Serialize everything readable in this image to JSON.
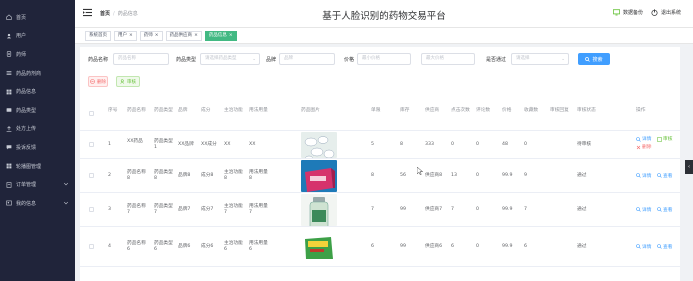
{
  "sidebar": {
    "items": [
      {
        "label": "首页",
        "icon": "home-icon",
        "caret": false
      },
      {
        "label": "用户",
        "icon": "user-icon",
        "caret": false
      },
      {
        "label": "药师",
        "icon": "pharmacist-icon",
        "caret": false
      },
      {
        "label": "药品药剂商",
        "icon": "supplier-icon",
        "caret": false
      },
      {
        "label": "药品信息",
        "icon": "drug-info-icon",
        "caret": false
      },
      {
        "label": "药品类型",
        "icon": "drug-type-icon",
        "caret": false
      },
      {
        "label": "处方上传",
        "icon": "upload-icon",
        "caret": false
      },
      {
        "label": "投诉反馈",
        "icon": "feedback-icon",
        "caret": false
      },
      {
        "label": "轮播图管理",
        "icon": "carousel-icon",
        "caret": false
      },
      {
        "label": "订单管理",
        "icon": "order-icon",
        "caret": true
      },
      {
        "label": "我的信息",
        "icon": "profile-icon",
        "caret": true
      }
    ]
  },
  "header": {
    "breadcrumb_home": "首页",
    "breadcrumb_current": "药品信息",
    "system_title": "基于人脸识别的药物交易平台",
    "backup_label": "数据备份",
    "logout_label": "退出系统"
  },
  "tabs": [
    {
      "label": "系统首页",
      "closable": false,
      "active": false
    },
    {
      "label": "用户",
      "closable": true,
      "active": false
    },
    {
      "label": "药师",
      "closable": true,
      "active": false
    },
    {
      "label": "药品供应商",
      "closable": true,
      "active": false
    },
    {
      "label": "药品信息",
      "closable": true,
      "active": true
    }
  ],
  "search": {
    "name_label": "药品名称",
    "name_placeholder": "药品名称",
    "type_label": "药品类型",
    "type_placeholder": "请选择药品类型",
    "brand_label": "品牌",
    "brand_placeholder": "品牌",
    "price_label": "价格",
    "price_min_placeholder": "最小价格",
    "price_max_placeholder": "最大价格",
    "audit_label": "是否通过",
    "audit_placeholder": "请选择",
    "search_button": "搜索"
  },
  "actions": {
    "delete_label": "删除",
    "audit_label": "审核"
  },
  "table": {
    "columns": [
      "序号",
      "药品名称",
      "药品类型",
      "品牌",
      "成分",
      "主治功能",
      "用法用量",
      "药品图片",
      "单限",
      "库存",
      "供应商",
      "点击次数",
      "评论数",
      "价格",
      "收藏数",
      "审核回复",
      "审核状态",
      "操作"
    ],
    "rows": [
      {
        "index": "1",
        "name": "XX药品",
        "type": "药品类型1",
        "brand": "XX品牌",
        "ingredient": "XX成分",
        "function": "XX",
        "usage": "XX",
        "image": "white-pills",
        "limit": "5",
        "stock": "8",
        "supplier": "333",
        "clicks": "0",
        "comments": "0",
        "price": "48",
        "favorites": "0",
        "reply": "",
        "status": "待审核",
        "has_audit": true
      },
      {
        "index": "2",
        "name": "药品名称8",
        "type": "药品类型8",
        "brand": "品牌8",
        "ingredient": "成分8",
        "function": "主治功能8",
        "usage": "用法用量8",
        "image": "red-box",
        "limit": "8",
        "stock": "56",
        "supplier": "供应商8",
        "clicks": "13",
        "comments": "0",
        "price": "99.9",
        "favorites": "9",
        "reply": "",
        "status": "通过",
        "has_audit": false
      },
      {
        "index": "3",
        "name": "药品名称7",
        "type": "药品类型7",
        "brand": "品牌7",
        "ingredient": "成分7",
        "function": "主治功能7",
        "usage": "用法用量7",
        "image": "green-bottle",
        "limit": "7",
        "stock": "99",
        "supplier": "供应商7",
        "clicks": "7",
        "comments": "0",
        "price": "99.9",
        "favorites": "7",
        "reply": "",
        "status": "通过",
        "has_audit": false
      },
      {
        "index": "4",
        "name": "药品名称6",
        "type": "药品类型6",
        "brand": "品牌6",
        "ingredient": "成分6",
        "function": "主治功能6",
        "usage": "用法用量6",
        "image": "green-box",
        "limit": "6",
        "stock": "99",
        "supplier": "供应商6",
        "clicks": "6",
        "comments": "0",
        "price": "99.9",
        "favorites": "6",
        "reply": "",
        "status": "通过",
        "has_audit": false
      }
    ],
    "op_detail": "详情",
    "op_audit": "审核",
    "op_delete": "删除",
    "op_view": "查看"
  },
  "colors": {
    "sidebar_bg": "#20243a",
    "primary": "#409eff",
    "success": "#67c23a",
    "danger": "#f56c6c",
    "active_tab": "#42b983"
  }
}
